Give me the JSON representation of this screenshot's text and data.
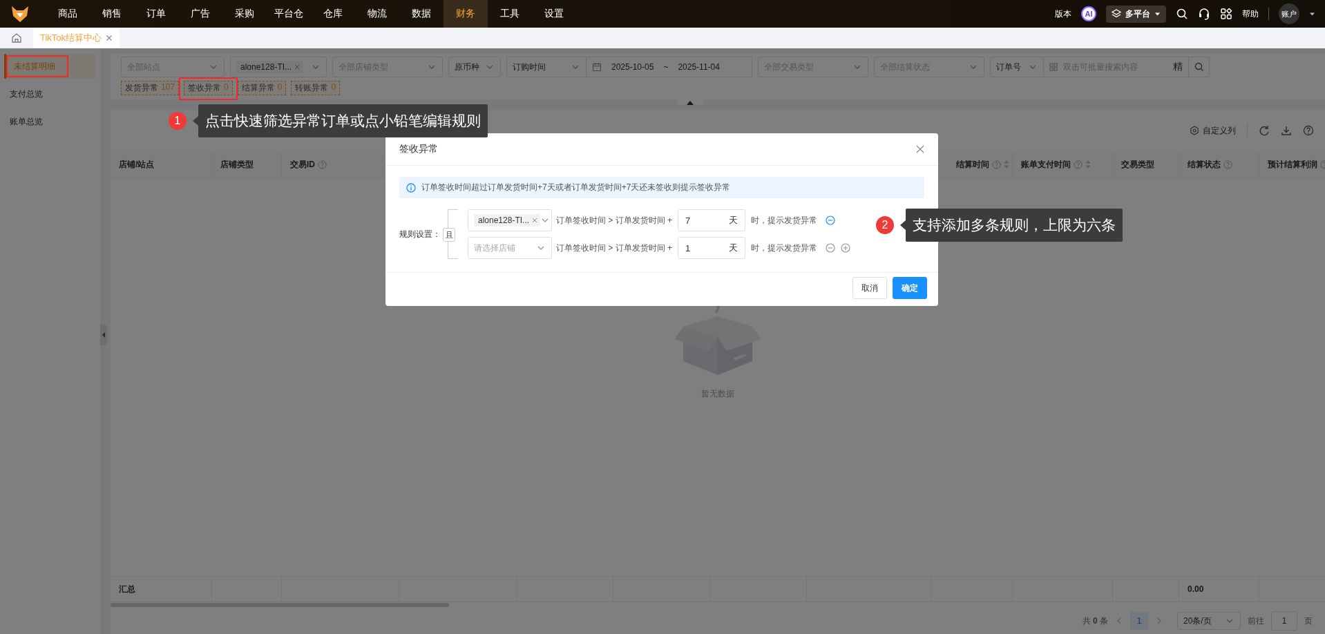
{
  "top_nav": {
    "menu": [
      {
        "label": "商品",
        "selected": false
      },
      {
        "label": "销售",
        "selected": false
      },
      {
        "label": "订单",
        "selected": false
      },
      {
        "label": "广告",
        "selected": false
      },
      {
        "label": "采购",
        "selected": false
      },
      {
        "label": "平台仓",
        "selected": false
      },
      {
        "label": "仓库",
        "selected": false
      },
      {
        "label": "物流",
        "selected": false
      },
      {
        "label": "数据",
        "selected": false
      },
      {
        "label": "财务",
        "selected": true
      },
      {
        "label": "工具",
        "selected": false
      },
      {
        "label": "设置",
        "selected": false
      }
    ],
    "version": "版本",
    "ai": "AI",
    "platform": "多平台",
    "help": "帮助",
    "account": "账户"
  },
  "tabs": [
    {
      "label": "TikTok结算中心",
      "selected": true
    }
  ],
  "sidebar": {
    "items": [
      {
        "label": "未结算明细",
        "selected": true,
        "annotated": true
      },
      {
        "label": "支付总览",
        "selected": false,
        "annotated": false
      },
      {
        "label": "账单总览",
        "selected": false,
        "annotated": false
      }
    ]
  },
  "filters": {
    "site": {
      "placeholder": "全部站点"
    },
    "store": {
      "tag": "alone128-TI..."
    },
    "store_type": {
      "placeholder": "全部店铺类型"
    },
    "currency": {
      "value": "原币种"
    },
    "date_type": {
      "value": "订购时间"
    },
    "date_start": "2025-10-05",
    "date_sep": "~",
    "date_end": "2025-11-04",
    "trade_type": {
      "placeholder": "全部交易类型"
    },
    "settle_status": {
      "placeholder": "全部结算状态"
    },
    "search_type": {
      "value": "订单号"
    },
    "search": {
      "placeholder": "双击可批量搜索内容"
    },
    "exact": "精"
  },
  "quick_filters": [
    {
      "label": "发货异常",
      "count": "107",
      "annotated": false
    },
    {
      "label": "签收异常",
      "count": "0",
      "annotated": true
    },
    {
      "label": "结算异常",
      "count": "0",
      "annotated": false
    },
    {
      "label": "转账异常",
      "count": "0",
      "annotated": false
    }
  ],
  "toolbar": {
    "custom_columns": "自定义列"
  },
  "table": {
    "columns": [
      {
        "label": "店铺/站点",
        "help": false,
        "sortable": false
      },
      {
        "label": "店铺类型",
        "help": false,
        "sortable": false
      },
      {
        "label": "交易ID",
        "help": true,
        "sortable": false
      },
      {
        "label": "结算时间",
        "help": true,
        "sortable": true
      },
      {
        "label": "账单支付时间",
        "help": true,
        "sortable": true
      },
      {
        "label": "交易类型",
        "help": false,
        "sortable": false
      },
      {
        "label": "结算状态",
        "help": true,
        "sortable": false
      },
      {
        "label": "预计结算利润",
        "help": true,
        "sortable": false
      }
    ],
    "empty_text": "暂无数据",
    "summary": {
      "label": "汇总",
      "total": "0.00"
    }
  },
  "pagination": {
    "total_prefix": "共",
    "total": "0",
    "total_suffix": "条",
    "pages": [
      {
        "label": "1",
        "selected": true
      }
    ],
    "page_size": "20条/页",
    "goto_label": "前往",
    "goto_value": "1",
    "goto_suffix": "页"
  },
  "dialog": {
    "title": "签收异常",
    "info": "订单签收时间超过订单发货时间+7天或者订单发货时间+7天还未签收则提示签收异常",
    "rule_label": "规则设置：",
    "logic": "且",
    "rules": [
      {
        "store_tag": "alone128-TI...",
        "condition": "订单签收时间 > 订单发货时间 +",
        "value": "7",
        "unit": "天",
        "result": "时，提示发货异常",
        "remove_active": true,
        "can_add": false
      },
      {
        "store_placeholder": "请选择店铺",
        "condition": "订单签收时间 > 订单发货时间 +",
        "value": "1",
        "unit": "天",
        "result": "时，提示发货异常",
        "remove_active": false,
        "can_add": true
      }
    ],
    "buttons": [
      {
        "label": "取消",
        "kind": "default"
      },
      {
        "label": "确定",
        "kind": "primary"
      }
    ]
  },
  "callouts": [
    {
      "number": "1",
      "text": "点击快速筛选异常订单或点小铅笔编辑规则"
    },
    {
      "number": "2",
      "text": "支持添加多条规则，上限为六条"
    }
  ]
}
